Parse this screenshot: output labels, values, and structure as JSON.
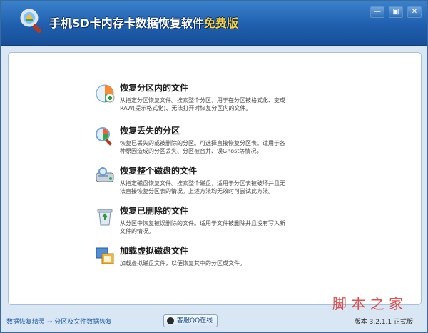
{
  "window": {
    "title_main": "手机SD卡内存卡数据恢复软件",
    "title_free": "免费版",
    "buttons": [
      "—",
      "▣",
      "✕"
    ]
  },
  "options": [
    {
      "title": "恢复分区内的文件",
      "desc": "从指定分区恢复文件。搜索整个分区，用于在分区被格式化、变成RAW(提示格式化)、无法打开时恢复分区内的文件。",
      "icon": "partition-restore-icon"
    },
    {
      "title": "恢复丢失的分区",
      "desc": "恢复已丢失的或被删除的分区。可选择直接恢复分区表。适用于各种原因造成的分区丢失、分区被合并、误Ghost等情况。",
      "icon": "lost-partition-icon"
    },
    {
      "title": "恢复整个磁盘的文件",
      "desc": "从指定磁盘恢复文件。搜索整个磁盘，适用于分区表被破坏并且无法直接恢复分区表的情况。上述方法均无效时可尝试此方法。",
      "icon": "disk-recovery-icon"
    },
    {
      "title": "恢复已删除的文件",
      "desc": "从分区中恢复被误删除的文件。适用于文件被删除并且没有写入新文件的情况。",
      "icon": "recycle-bin-icon"
    },
    {
      "title": "加载虚拟磁盘文件",
      "desc": "加载虚拟磁盘文件，以便恢复其中的分区或文件。",
      "icon": "virtual-disk-icon"
    }
  ],
  "status": {
    "breadcrumb": "数据恢复精灵 → 分区及文件数据恢复",
    "qq_label": "客服QQ在线",
    "version": "版本 3.2.1.1 正式版"
  },
  "watermark": "脚 本 之 家"
}
